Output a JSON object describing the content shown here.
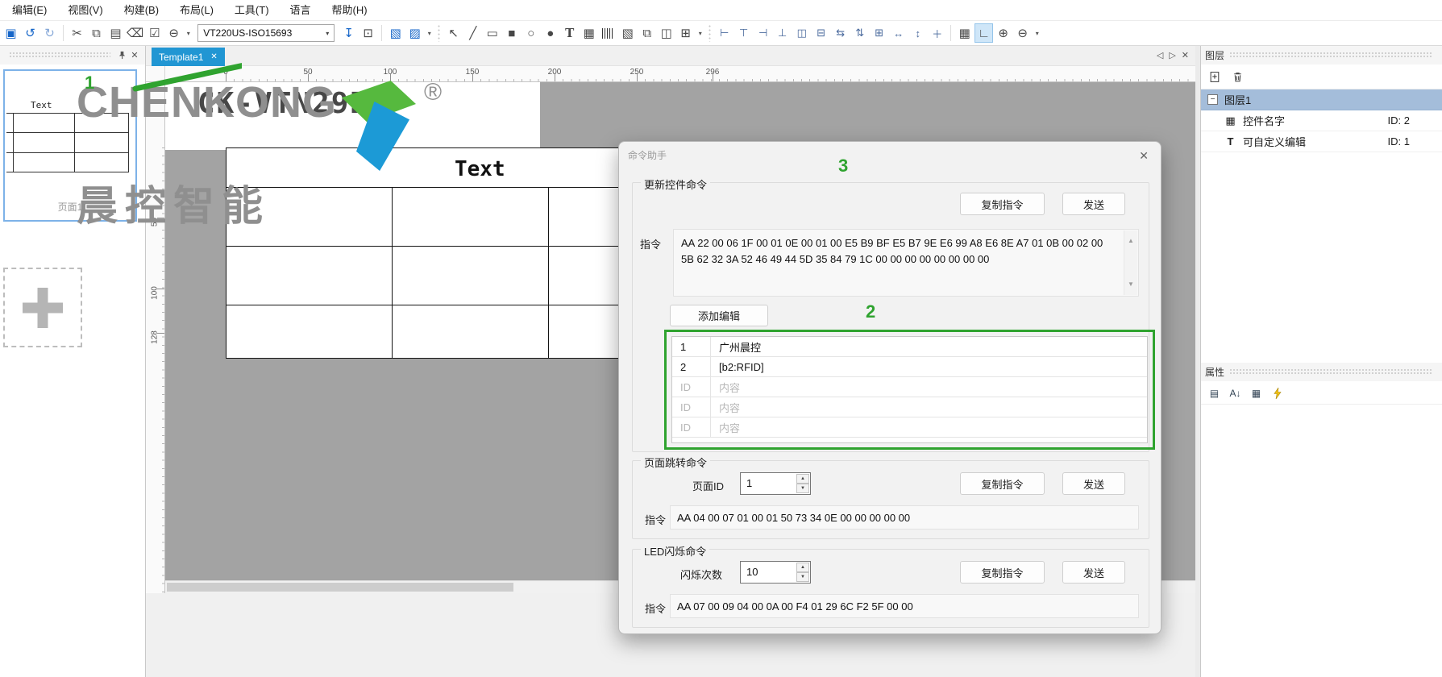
{
  "menu": {
    "items": [
      "编辑(E)",
      "视图(V)",
      "构建(B)",
      "布局(L)",
      "工具(T)",
      "语言",
      "帮助(H)"
    ]
  },
  "toolbar": {
    "device_model": "VT220US-ISO15693",
    "items": [
      {
        "kind": "i",
        "name": "save-icon",
        "glyph": "▣",
        "cls": "blue"
      },
      {
        "kind": "i",
        "name": "undo-icon",
        "glyph": "↺",
        "cls": "blue"
      },
      {
        "kind": "i",
        "name": "redo-icon",
        "glyph": "↻",
        "cls": "lblue"
      },
      {
        "kind": "s"
      },
      {
        "kind": "i",
        "name": "cut-icon",
        "glyph": "✂"
      },
      {
        "kind": "i",
        "name": "copy-icon",
        "glyph": "⧉"
      },
      {
        "kind": "i",
        "name": "paste-icon",
        "glyph": "▤"
      },
      {
        "kind": "i",
        "name": "delete-icon",
        "glyph": "⌫"
      },
      {
        "kind": "i",
        "name": "check-icon",
        "glyph": "☑"
      },
      {
        "kind": "i",
        "name": "remove-circle-icon",
        "glyph": "⊖"
      },
      {
        "kind": "i",
        "name": "dropdown-icon",
        "glyph": "▾",
        "cls": "dd"
      },
      {
        "kind": "combo"
      },
      {
        "kind": "i",
        "name": "import-icon",
        "glyph": "↧",
        "cls": "blue"
      },
      {
        "kind": "i",
        "name": "device-icon",
        "glyph": "⊡"
      },
      {
        "kind": "s"
      },
      {
        "kind": "i",
        "name": "export-image-icon",
        "glyph": "▧",
        "cls": "blue"
      },
      {
        "kind": "i",
        "name": "export-template-icon",
        "glyph": "▨",
        "cls": "blue"
      },
      {
        "kind": "i",
        "name": "dropdown-icon",
        "glyph": "▾",
        "cls": "dd"
      },
      {
        "kind": "d"
      },
      {
        "kind": "i",
        "name": "select-cursor-icon",
        "glyph": "↖"
      },
      {
        "kind": "i",
        "name": "line-tool-icon",
        "glyph": "╱"
      },
      {
        "kind": "i",
        "name": "rect-tool-icon",
        "glyph": "▭"
      },
      {
        "kind": "i",
        "name": "filled-rect-tool-icon",
        "glyph": "■"
      },
      {
        "kind": "i",
        "name": "ellipse-tool-icon",
        "glyph": "○"
      },
      {
        "kind": "i",
        "name": "filled-ellipse-tool-icon",
        "glyph": "●"
      },
      {
        "kind": "i",
        "name": "text-tool-icon",
        "glyph": "T",
        "cls": "serif"
      },
      {
        "kind": "i",
        "name": "qrcode-tool-icon",
        "glyph": "▦"
      },
      {
        "kind": "bar",
        "name": "barcode-tool-icon"
      },
      {
        "kind": "i",
        "name": "image-tool-icon",
        "glyph": "▧"
      },
      {
        "kind": "i",
        "name": "gallery-tool-icon",
        "glyph": "⧉"
      },
      {
        "kind": "i",
        "name": "panel-tool-icon",
        "glyph": "◫"
      },
      {
        "kind": "i",
        "name": "table-tool-icon",
        "glyph": "⊞"
      },
      {
        "kind": "i",
        "name": "dropdown-icon",
        "glyph": "▾",
        "cls": "dd"
      },
      {
        "kind": "d"
      },
      {
        "kind": "i",
        "name": "align-left-icon",
        "glyph": "⊢",
        "cls": "al"
      },
      {
        "kind": "i",
        "name": "align-top-icon",
        "glyph": "⊤",
        "cls": "al"
      },
      {
        "kind": "i",
        "name": "align-right-icon",
        "glyph": "⊣",
        "cls": "al"
      },
      {
        "kind": "i",
        "name": "align-bottom-icon",
        "glyph": "⊥",
        "cls": "al"
      },
      {
        "kind": "i",
        "name": "center-horizontal-icon",
        "glyph": "◫",
        "cls": "al"
      },
      {
        "kind": "i",
        "name": "center-vertical-icon",
        "glyph": "⊟",
        "cls": "al"
      },
      {
        "kind": "i",
        "name": "distribute-horizontal-icon",
        "glyph": "⇆",
        "cls": "al"
      },
      {
        "kind": "i",
        "name": "distribute-vertical-icon",
        "glyph": "⇅",
        "cls": "al"
      },
      {
        "kind": "i",
        "name": "center-in-page-icon",
        "glyph": "⊞",
        "cls": "al"
      },
      {
        "kind": "i",
        "name": "same-width-icon",
        "glyph": "↔",
        "cls": "al"
      },
      {
        "kind": "i",
        "name": "same-height-icon",
        "glyph": "↕",
        "cls": "al"
      },
      {
        "kind": "i",
        "name": "same-size-icon",
        "glyph": "＋",
        "cls": "al"
      },
      {
        "kind": "s"
      },
      {
        "kind": "i",
        "name": "grid-icon",
        "glyph": "▦"
      },
      {
        "kind": "i",
        "name": "ruler-icon",
        "glyph": "∟",
        "cls": "active"
      },
      {
        "kind": "i",
        "name": "zoom-in-icon",
        "glyph": "⊕"
      },
      {
        "kind": "i",
        "name": "zoom-out-icon",
        "glyph": "⊖"
      },
      {
        "kind": "i",
        "name": "dropdown-icon",
        "glyph": "▾",
        "cls": "dd"
      }
    ]
  },
  "icons": {
    "close": "✕",
    "pin": "pin",
    "dropdown": "▾",
    "up": "▲",
    "down": "▼",
    "nav_left": "◁",
    "nav_right": "▷",
    "expand_minus": "−",
    "tree_table": "▦",
    "tree_text": "T",
    "prop_cat": "▤",
    "prop_alpha": "A↓",
    "prop_grid": "▦"
  },
  "tabs": {
    "template_tab": "Template1"
  },
  "left_panel": {
    "thumb_text": "Text",
    "page_caption": "页面1"
  },
  "canvas": {
    "product_text": "CK-VTN29BU",
    "text_control": "Text",
    "h_ruler": [
      "0",
      "50",
      "100",
      "150",
      "200",
      "250",
      "296"
    ],
    "v_ruler": [
      "50",
      "100",
      "128"
    ]
  },
  "watermark": {
    "line1": "CHENKONG",
    "reg": "®",
    "line2": "晨控智能"
  },
  "dialog": {
    "title": "命令助手",
    "update": {
      "title": "更新控件命令",
      "copy_btn": "复制指令",
      "send_btn": "发送",
      "cmd_label": "指令",
      "cmd_line1": "AA 22 00 06 1F 00 01 0E 00 01 00 E5 B9 BF E5 B7 9E E6 99 A8 E6 8E A7 01 0B 00 02 00",
      "cmd_line2": "5B 62 32 3A 52 46 49 44 5D 35 84 79 1C 00 00 00 00 00 00 00 00",
      "add_btn": "添加编辑",
      "rows": [
        {
          "id": "1",
          "content": "广州晨控",
          "placeholder": false
        },
        {
          "id": "2",
          "content": "[b2:RFID]",
          "placeholder": false
        },
        {
          "id": "ID",
          "content": "内容",
          "placeholder": true
        },
        {
          "id": "ID",
          "content": "内容",
          "placeholder": true
        },
        {
          "id": "ID",
          "content": "内容",
          "placeholder": true
        }
      ]
    },
    "page_jump": {
      "title": "页面跳转命令",
      "field_label": "页面ID",
      "field_value": "1",
      "copy_btn": "复制指令",
      "send_btn": "发送",
      "cmd_label": "指令",
      "cmd": "AA 04 00 07 01 00 01 50 73 34 0E 00 00 00 00 00"
    },
    "led": {
      "title": "LED闪烁命令",
      "field_label": "闪烁次数",
      "field_value": "10",
      "copy_btn": "复制指令",
      "send_btn": "发送",
      "cmd_label": "指令",
      "cmd": "AA 07 00 09 04 00 0A 00 F4 01 29 6C F2 5F 00 00"
    }
  },
  "annotations": {
    "step1": "1",
    "step2": "2",
    "step3": "3",
    "green": "#2fa32f"
  },
  "layers_panel": {
    "title": "图层",
    "root_layer": "图层1",
    "items": [
      {
        "name": "控件名字",
        "id_label": "ID: 2",
        "type": "table"
      },
      {
        "name": "可自定义编辑",
        "id_label": "ID: 1",
        "type": "text"
      }
    ]
  },
  "properties_panel": {
    "title": "属性"
  }
}
